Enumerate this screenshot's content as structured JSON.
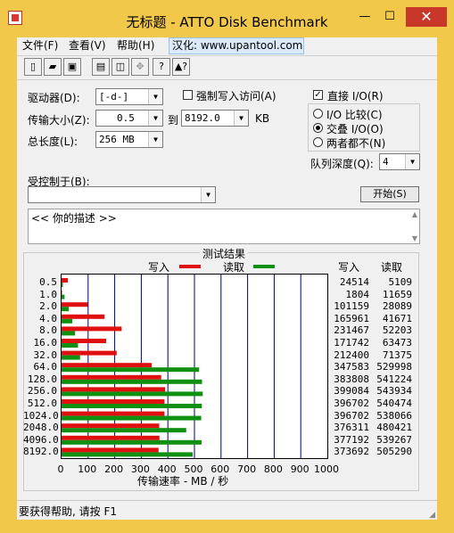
{
  "window": {
    "title": "无标题 - ATTO Disk Benchmark",
    "min": "—",
    "max": "☐",
    "close": "✕"
  },
  "menu": [
    "文件(F)",
    "查看(V)",
    "帮助(H)",
    "汉化: www.upantool.com"
  ],
  "toolbar": {
    "icons": [
      "new-icon",
      "open-icon",
      "save-icon",
      "print-icon",
      "print-preview-icon",
      "move-icon",
      "help-icon",
      "context-help-icon"
    ]
  },
  "form": {
    "drive_label": "驱动器(D):",
    "drive_value": "[-d-]",
    "force_write_label": "强制写入访问(A)",
    "transfer_label": "传输大小(Z):",
    "transfer_from": "0.5",
    "to_label": "到",
    "transfer_to": "8192.0",
    "kb": "KB",
    "length_label": "总长度(L):",
    "length_value": "256 MB",
    "direct_io_label": "直接 I/O(R)",
    "direct_io_checked": true,
    "io_compare": "I/O 比较(C)",
    "overlap_io": "交叠 I/O(O)",
    "neither": "两者都不(N)",
    "selected": "overlap_io",
    "queue_label": "队列深度(Q):",
    "queue_value": "4",
    "controlled_label": "受控制于(B):",
    "controlled_value": "",
    "start_button": "开始(S)",
    "description": "<<  你的描述   >>"
  },
  "results": {
    "title": "测试结果",
    "write_legend": "写入",
    "read_legend": "读取",
    "write_header": "写入",
    "read_header": "读取",
    "xlabel": "传输速率 - MB / 秒"
  },
  "chart_data": {
    "type": "bar",
    "title": "测试结果",
    "xlabel": "传输速率 - MB / 秒",
    "xlim": [
      0,
      1000
    ],
    "xticks": [
      0,
      100,
      200,
      300,
      400,
      500,
      600,
      700,
      800,
      900,
      1000
    ],
    "categories": [
      "0.5",
      "1.0",
      "2.0",
      "4.0",
      "8.0",
      "16.0",
      "32.0",
      "64.0",
      "128.0",
      "256.0",
      "512.0",
      "1024.0",
      "2048.0",
      "4096.0",
      "8192.0"
    ],
    "series": [
      {
        "name": "写入",
        "color": "#e01010",
        "values": [
          24514,
          1804,
          101159,
          165961,
          231467,
          171742,
          212400,
          347583,
          383808,
          399084,
          396702,
          396702,
          376311,
          377192,
          373692
        ]
      },
      {
        "name": "读取",
        "color": "#109010",
        "values": [
          5109,
          11659,
          28089,
          41671,
          52203,
          63473,
          71375,
          529998,
          541224,
          543934,
          540474,
          538066,
          480421,
          539267,
          505290
        ]
      }
    ]
  },
  "status": {
    "text": "要获得帮助, 请按 F1"
  },
  "colors": {
    "titlebar": "#f2c84b",
    "close": "#c7382b",
    "write": "#e01010",
    "read": "#109010"
  }
}
